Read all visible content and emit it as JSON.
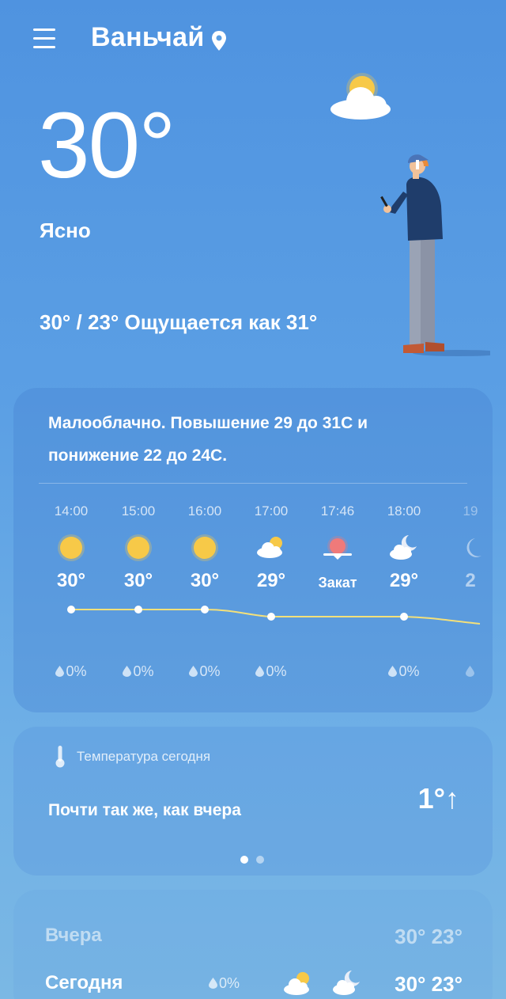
{
  "header": {
    "city": "Ваньчай"
  },
  "current": {
    "temperature": "30°",
    "condition": "Ясно",
    "range_feels": "30° / 23° Ощущается как 31°"
  },
  "hourly_card": {
    "summary": "Малооблачно. Повышение 29 до 31C и понижение 22 до 24C.",
    "hours": [
      {
        "time": "14:00",
        "icon": "sun-icon",
        "temp": "30°",
        "precip": "0%"
      },
      {
        "time": "15:00",
        "icon": "sun-icon",
        "temp": "30°",
        "precip": "0%"
      },
      {
        "time": "16:00",
        "icon": "sun-icon",
        "temp": "30°",
        "precip": "0%"
      },
      {
        "time": "17:00",
        "icon": "sun-cloud-icon",
        "temp": "29°",
        "precip": "0%"
      },
      {
        "time": "17:46",
        "icon": "sunset-icon",
        "label": "Закат"
      },
      {
        "time": "18:00",
        "icon": "moon-cloud-icon",
        "temp": "29°",
        "precip": "0%"
      },
      {
        "time": "19",
        "icon": "moon-icon",
        "temp": "2",
        "precip": ""
      }
    ]
  },
  "today_card": {
    "title": "Температура сегодня",
    "text": "Почти так же, как вчера",
    "delta": "1°↑"
  },
  "daily_card": {
    "rows": [
      {
        "day": "Вчера",
        "temps": "30° 23°"
      },
      {
        "day": "Сегодня",
        "precip": "0%",
        "temps": "30° 23°",
        "icon_day": "sun-cloud-icon",
        "icon_night": "moon-cloud-icon"
      }
    ]
  },
  "colors": {
    "background_top": "#4f93e0",
    "background_bottom": "#7bb8e4",
    "sun": "#f7c948",
    "temp_line": "#f3e07a",
    "sunset": "#f07a7a"
  }
}
